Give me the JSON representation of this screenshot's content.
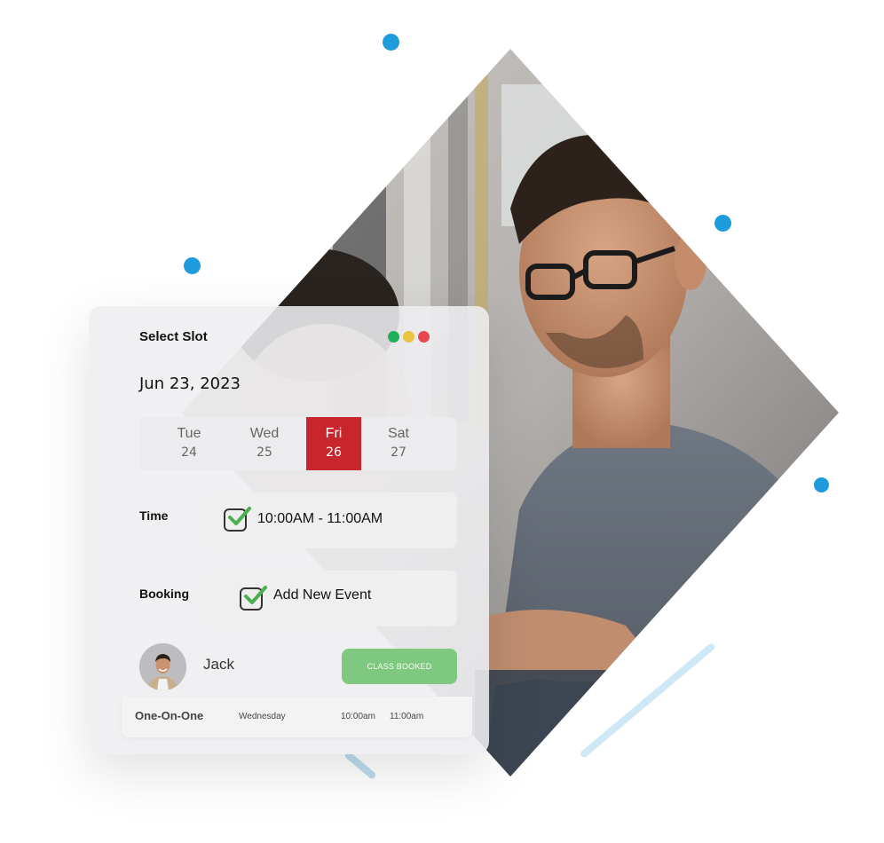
{
  "colors": {
    "accent_blue": "#1e9bdc",
    "selected_day": "#c8262d",
    "booked_green": "#7ec97f",
    "check_green": "#4caf50",
    "dot_green": "#1fae5a",
    "dot_yellow": "#e8c440",
    "dot_red": "#e8484f"
  },
  "card": {
    "title": "Select Slot",
    "window_dots": [
      "green",
      "yellow",
      "red"
    ],
    "date": "Jun 23, 2023",
    "days": [
      {
        "name": "Tue",
        "num": "24",
        "selected": false
      },
      {
        "name": "Wed",
        "num": "25",
        "selected": false
      },
      {
        "name": "Fri",
        "num": "26",
        "selected": true
      },
      {
        "name": "Sat",
        "num": "27",
        "selected": false
      }
    ],
    "time": {
      "label": "Time",
      "value": "10:00AM - 11:00AM",
      "checked": true
    },
    "booking": {
      "label": "Booking",
      "value": "Add New Event",
      "checked": true
    },
    "user": {
      "name": "Jack",
      "avatar": "user-photo"
    },
    "status_button": "CLASS BOOKED",
    "session": {
      "type": "One-On-One",
      "day": "Wednesday",
      "start": "10:00am",
      "end": "11:00am"
    }
  },
  "hero_image": "man-with-glasses-in-gym"
}
